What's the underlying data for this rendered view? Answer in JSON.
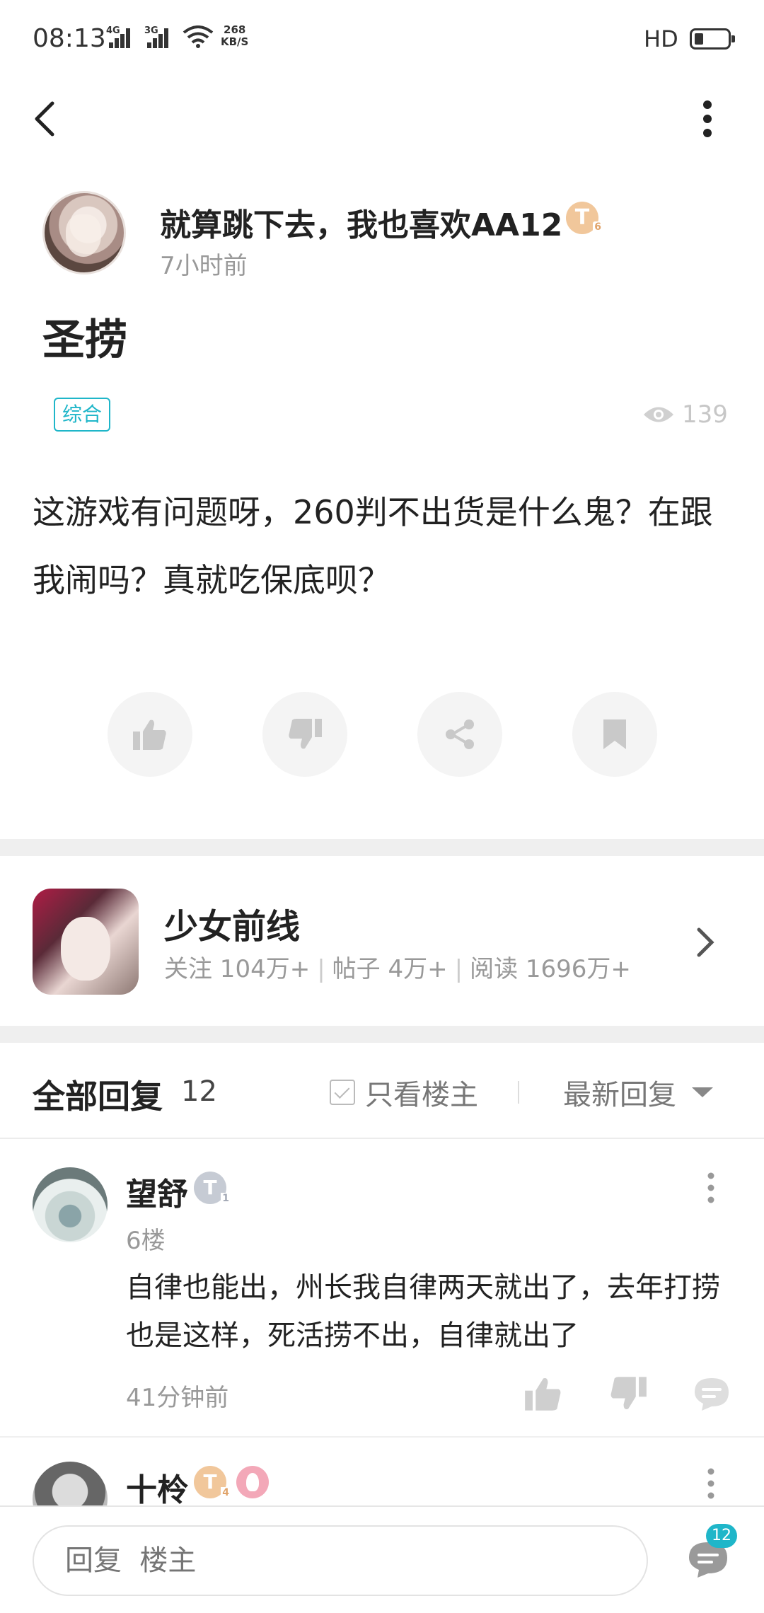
{
  "status_bar": {
    "time": "08:13",
    "net1": "4G",
    "net2": "3G",
    "speed_value": "268",
    "speed_unit": "KB/S",
    "hd": "HD"
  },
  "post": {
    "author": "就算跳下去，我也喜欢AA12",
    "author_level_badge": "T",
    "author_level_sub": "6",
    "time": "7小时前",
    "title": "圣捞",
    "tag": "综合",
    "views": "139",
    "body": "这游戏有问题呀，260判不出货是什么鬼？在跟我闹吗？真就吃保底呗？"
  },
  "game": {
    "name": "少女前线",
    "follow": "关注 104万+",
    "posts": "帖子 4万+",
    "reads": "阅读 1696万+",
    "sep": "|"
  },
  "replies_header": {
    "title": "全部回复",
    "count": "12",
    "only_op": "只看楼主",
    "sort": "最新回复"
  },
  "comments": [
    {
      "name": "望舒",
      "badge": "T",
      "badge_sub": "1",
      "floor": "6楼",
      "text": "自律也能出，州长我自律两天就出了，去年打捞也是这样，死活捞不出，自律就出了",
      "time": "41分钟前"
    },
    {
      "name": "十柃",
      "badge": "T",
      "badge_sub": "4"
    }
  ],
  "bottom_bar": {
    "placeholder": "回复  楼主",
    "reply_count": "12"
  },
  "colors": {
    "accent": "#1fb6c9",
    "gold_badge": "#f1c79b",
    "silver_badge": "#c6cbd4"
  }
}
